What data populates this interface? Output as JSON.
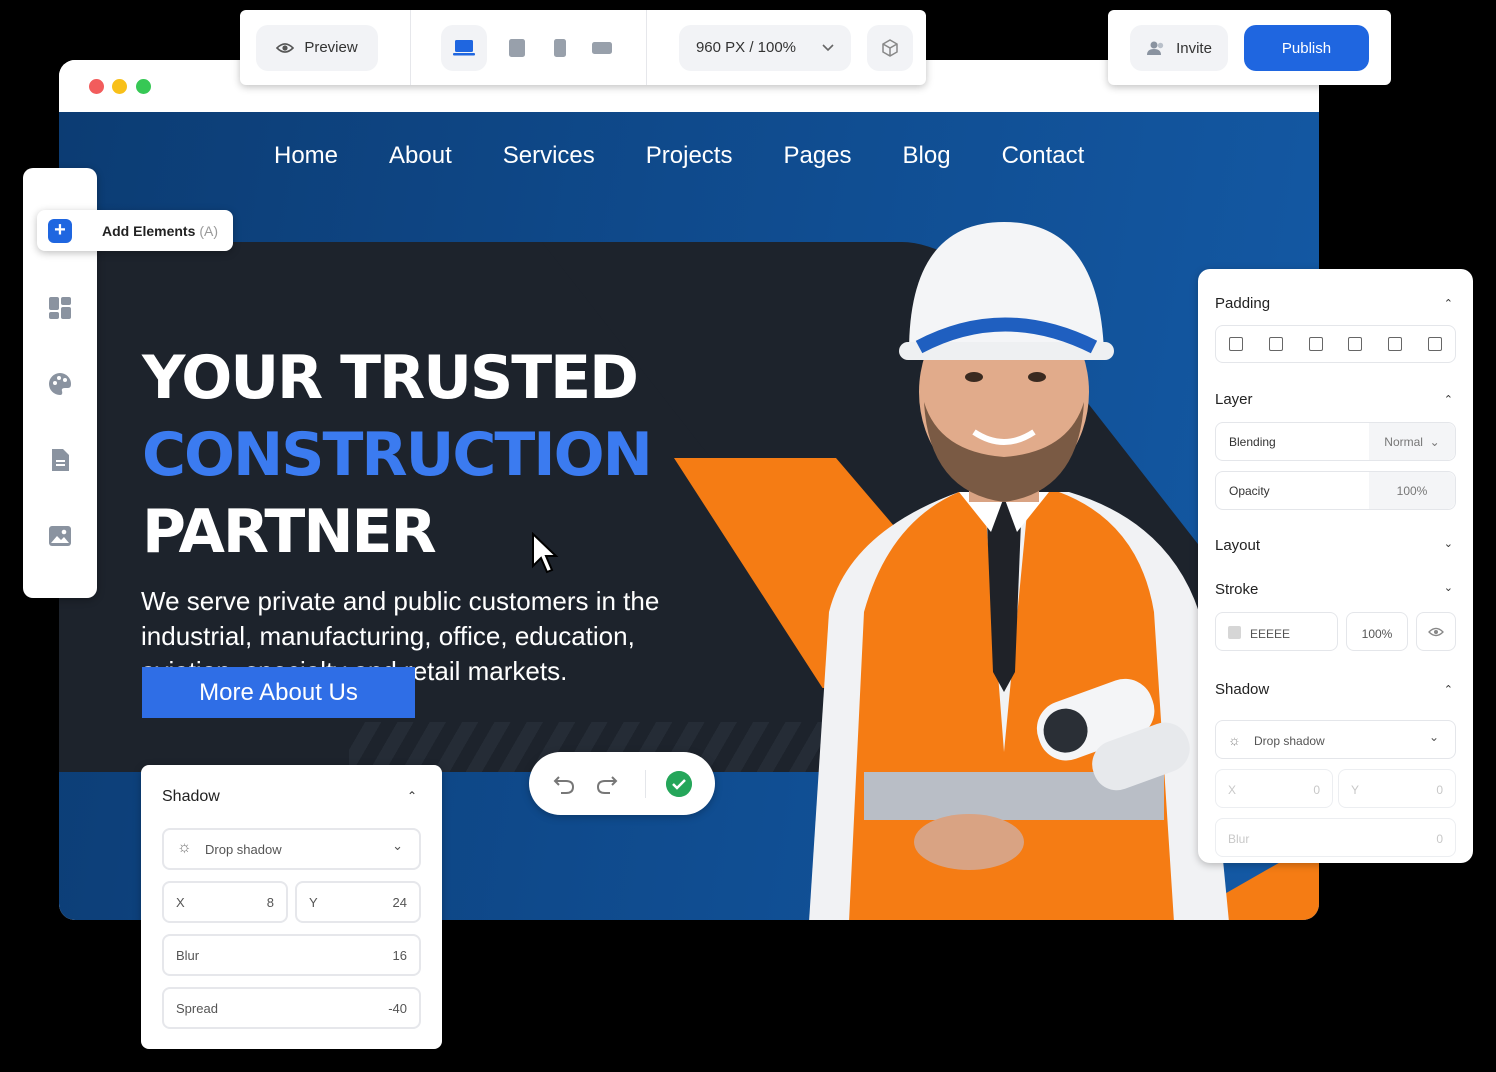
{
  "toolbar": {
    "preview_label": "Preview",
    "zoom_label": "960 PX / 100%"
  },
  "publish_bar": {
    "invite_label": "Invite",
    "publish_label": "Publish"
  },
  "sidebar": {
    "add_elements_label": "Add Elements",
    "add_elements_shortcut": "(A)"
  },
  "site": {
    "nav": [
      "Home",
      "About",
      "Services",
      "Projects",
      "Pages",
      "Blog",
      "Contact"
    ],
    "hero": {
      "line1": "YOUR TRUSTED",
      "line2": "CONSTRUCTION",
      "line3": "PARTNER",
      "description": "We serve private and public customers in the industrial, manufacturing, office, education, aviation, specialty and retail markets.",
      "cta": "More About Us"
    }
  },
  "properties": {
    "padding_title": "Padding",
    "layer_title": "Layer",
    "blending_label": "Blending",
    "blending_value": "Normal",
    "opacity_label": "Opacity",
    "opacity_value": "100%",
    "layout_title": "Layout",
    "stroke_title": "Stroke",
    "stroke_color": "EEEEE",
    "stroke_opacity": "100%",
    "shadow_title": "Shadow",
    "shadow_type": "Drop shadow",
    "x_label": "X",
    "x_value": "0",
    "y_label": "Y",
    "y_value": "0",
    "blur_label": "Blur",
    "blur_value": "0"
  },
  "shadow_panel": {
    "title": "Shadow",
    "type": "Drop shadow",
    "x_label": "X",
    "x_value": "8",
    "y_label": "Y",
    "y_value": "24",
    "blur_label": "Blur",
    "blur_value": "16",
    "spread_label": "Spread",
    "spread_value": "-40"
  },
  "colors": {
    "accent": "#1f66e0",
    "hero_blue": "#3b7bf0",
    "orange": "#f57c14",
    "dark": "#1d232c"
  }
}
